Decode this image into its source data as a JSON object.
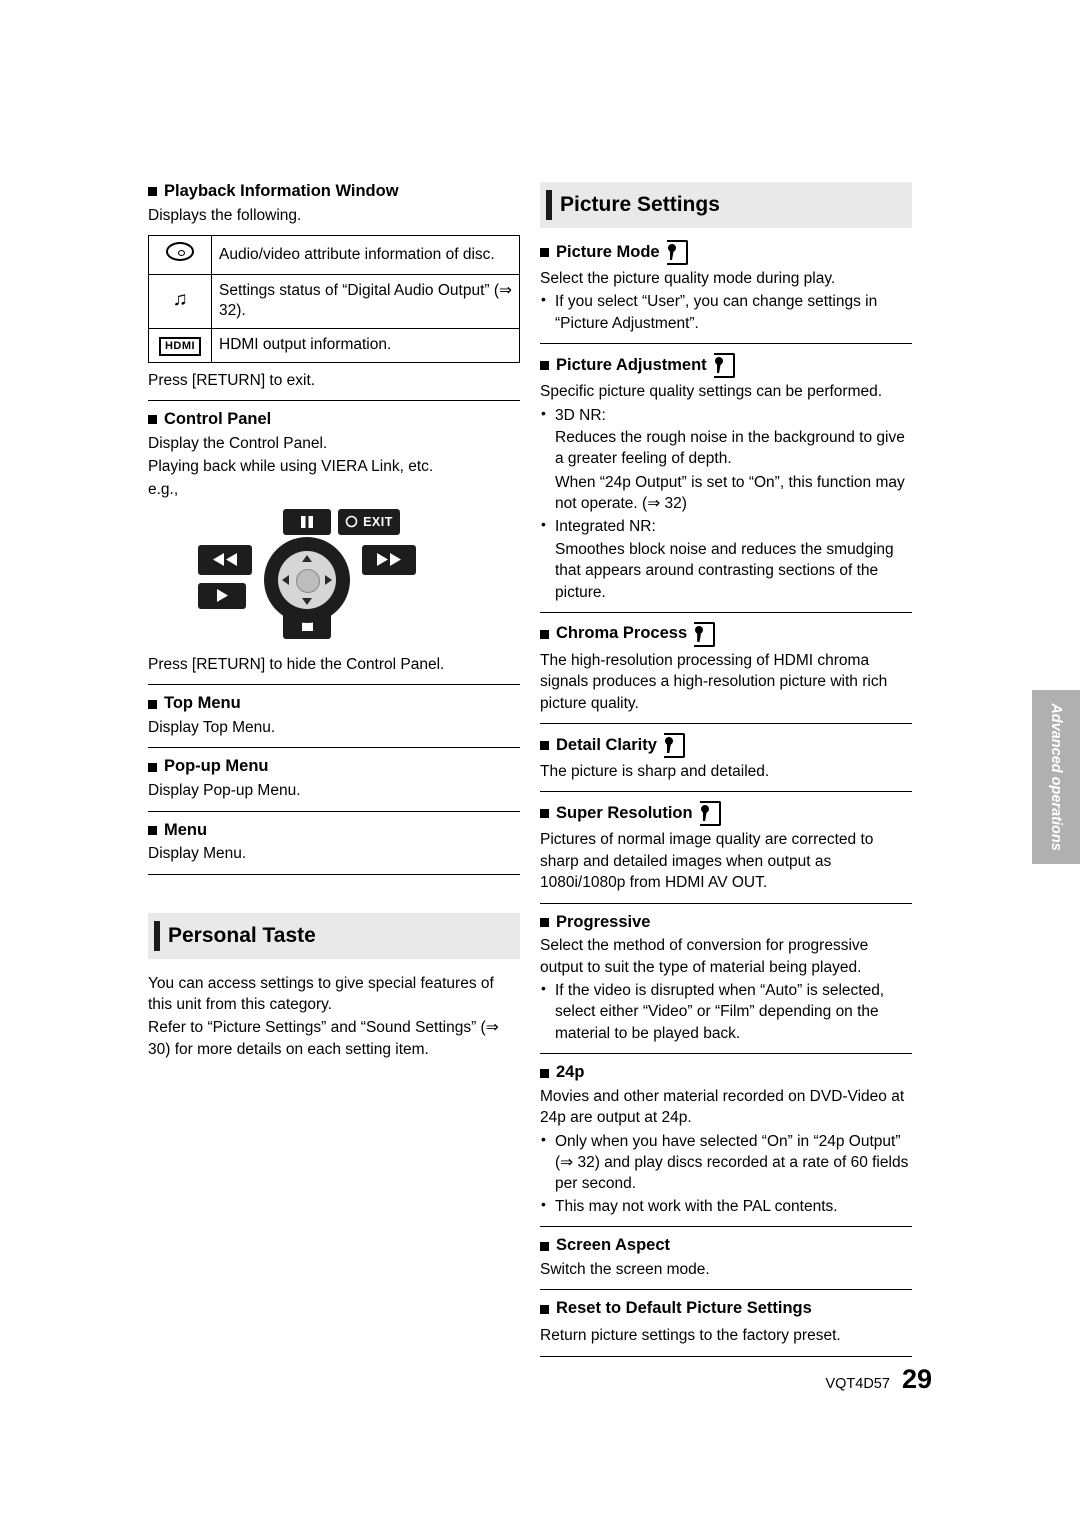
{
  "document": {
    "footer_code": "VQT4D57",
    "page_number": "29",
    "side_tab": "Advanced operations"
  },
  "left_column": {
    "playback_info": {
      "heading": "Playback Information Window",
      "intro": "Displays the following.",
      "table": [
        {
          "icon": "disc-icon",
          "text": "Audio/video attribute information of disc."
        },
        {
          "icon": "audio-note-icon",
          "text": "Settings status of “Digital Audio Output” (⇒ 32)."
        },
        {
          "icon": "hdmi-icon",
          "text": "HDMI output information."
        }
      ],
      "outro": "Press [RETURN] to exit."
    },
    "control_panel": {
      "heading": "Control Panel",
      "line1": "Display the Control Panel.",
      "line2": "Playing back while using VIERA Link, etc.",
      "line3": "e.g.,",
      "diagram": {
        "pause_button": "pause-icon",
        "exit_button": "EXIT",
        "rewind_button": "rewind-icon",
        "fastforward_button": "fast-forward-icon",
        "play_button": "play-icon",
        "stop_button": "stop-icon",
        "dpad": "direction-pad"
      },
      "outro": "Press [RETURN] to hide the Control Panel."
    },
    "top_menu": {
      "heading": "Top Menu",
      "text": "Display Top Menu."
    },
    "popup_menu": {
      "heading": "Pop-up Menu",
      "text": "Display Pop-up Menu."
    },
    "menu": {
      "heading": "Menu",
      "text": "Display Menu."
    },
    "personal_taste": {
      "heading": "Personal Taste",
      "p1": "You can access settings to give special features of this unit from this category.",
      "p2": "Refer to “Picture Settings” and “Sound Settings” (⇒ 30) for more details on each setting item."
    }
  },
  "right_column": {
    "heading": "Picture Settings",
    "sections": [
      {
        "heading": "Picture Mode",
        "has_key_icon": true,
        "body": [
          "Select the picture quality mode during play."
        ],
        "bullets": [
          "If you select “User”, you can change settings in “Picture Adjustment”."
        ]
      },
      {
        "heading": "Picture Adjustment",
        "has_key_icon": true,
        "body": [
          "Specific picture quality settings can be performed."
        ],
        "bullets": [],
        "sub_bullets": [
          {
            "label": "3D NR:",
            "lines": [
              "Reduces the rough noise in the background to give a greater feeling of depth.",
              "When “24p Output” is set to “On”, this function may not operate. (⇒ 32)"
            ]
          },
          {
            "label": "Integrated NR:",
            "lines": [
              "Smoothes block noise and reduces the smudging that appears around contrasting sections of the picture."
            ]
          }
        ]
      },
      {
        "heading": "Chroma Process",
        "has_key_icon": true,
        "body": [
          "The high-resolution processing of HDMI chroma signals produces a high-resolution picture with rich picture quality."
        ],
        "bullets": []
      },
      {
        "heading": "Detail Clarity",
        "has_key_icon": true,
        "body": [
          "The picture is sharp and detailed."
        ],
        "bullets": []
      },
      {
        "heading": "Super Resolution",
        "has_key_icon": true,
        "body": [
          "Pictures of normal image quality are corrected to sharp and detailed images when output as 1080i/1080p from HDMI AV OUT."
        ],
        "bullets": []
      },
      {
        "heading": "Progressive",
        "has_key_icon": false,
        "body": [
          "Select the method of conversion for progressive output to suit the type of material being played."
        ],
        "bullets": [
          "If the video is disrupted when “Auto” is selected, select either “Video” or “Film” depending on the material to be played back."
        ]
      },
      {
        "heading": "24p",
        "has_key_icon": false,
        "body": [
          "Movies and other material recorded on DVD-Video at 24p are output at 24p."
        ],
        "bullets": [
          "Only when you have selected “On” in “24p Output” (⇒ 32) and play discs recorded at a rate of 60 fields per second.",
          "This may not work with the PAL contents."
        ]
      },
      {
        "heading": "Screen Aspect",
        "has_key_icon": false,
        "body": [
          "Switch the screen mode."
        ],
        "bullets": []
      },
      {
        "heading": "Reset to Default Picture Settings",
        "has_key_icon": false,
        "body": [
          "Return picture settings to the factory preset."
        ],
        "bullets": []
      }
    ]
  }
}
